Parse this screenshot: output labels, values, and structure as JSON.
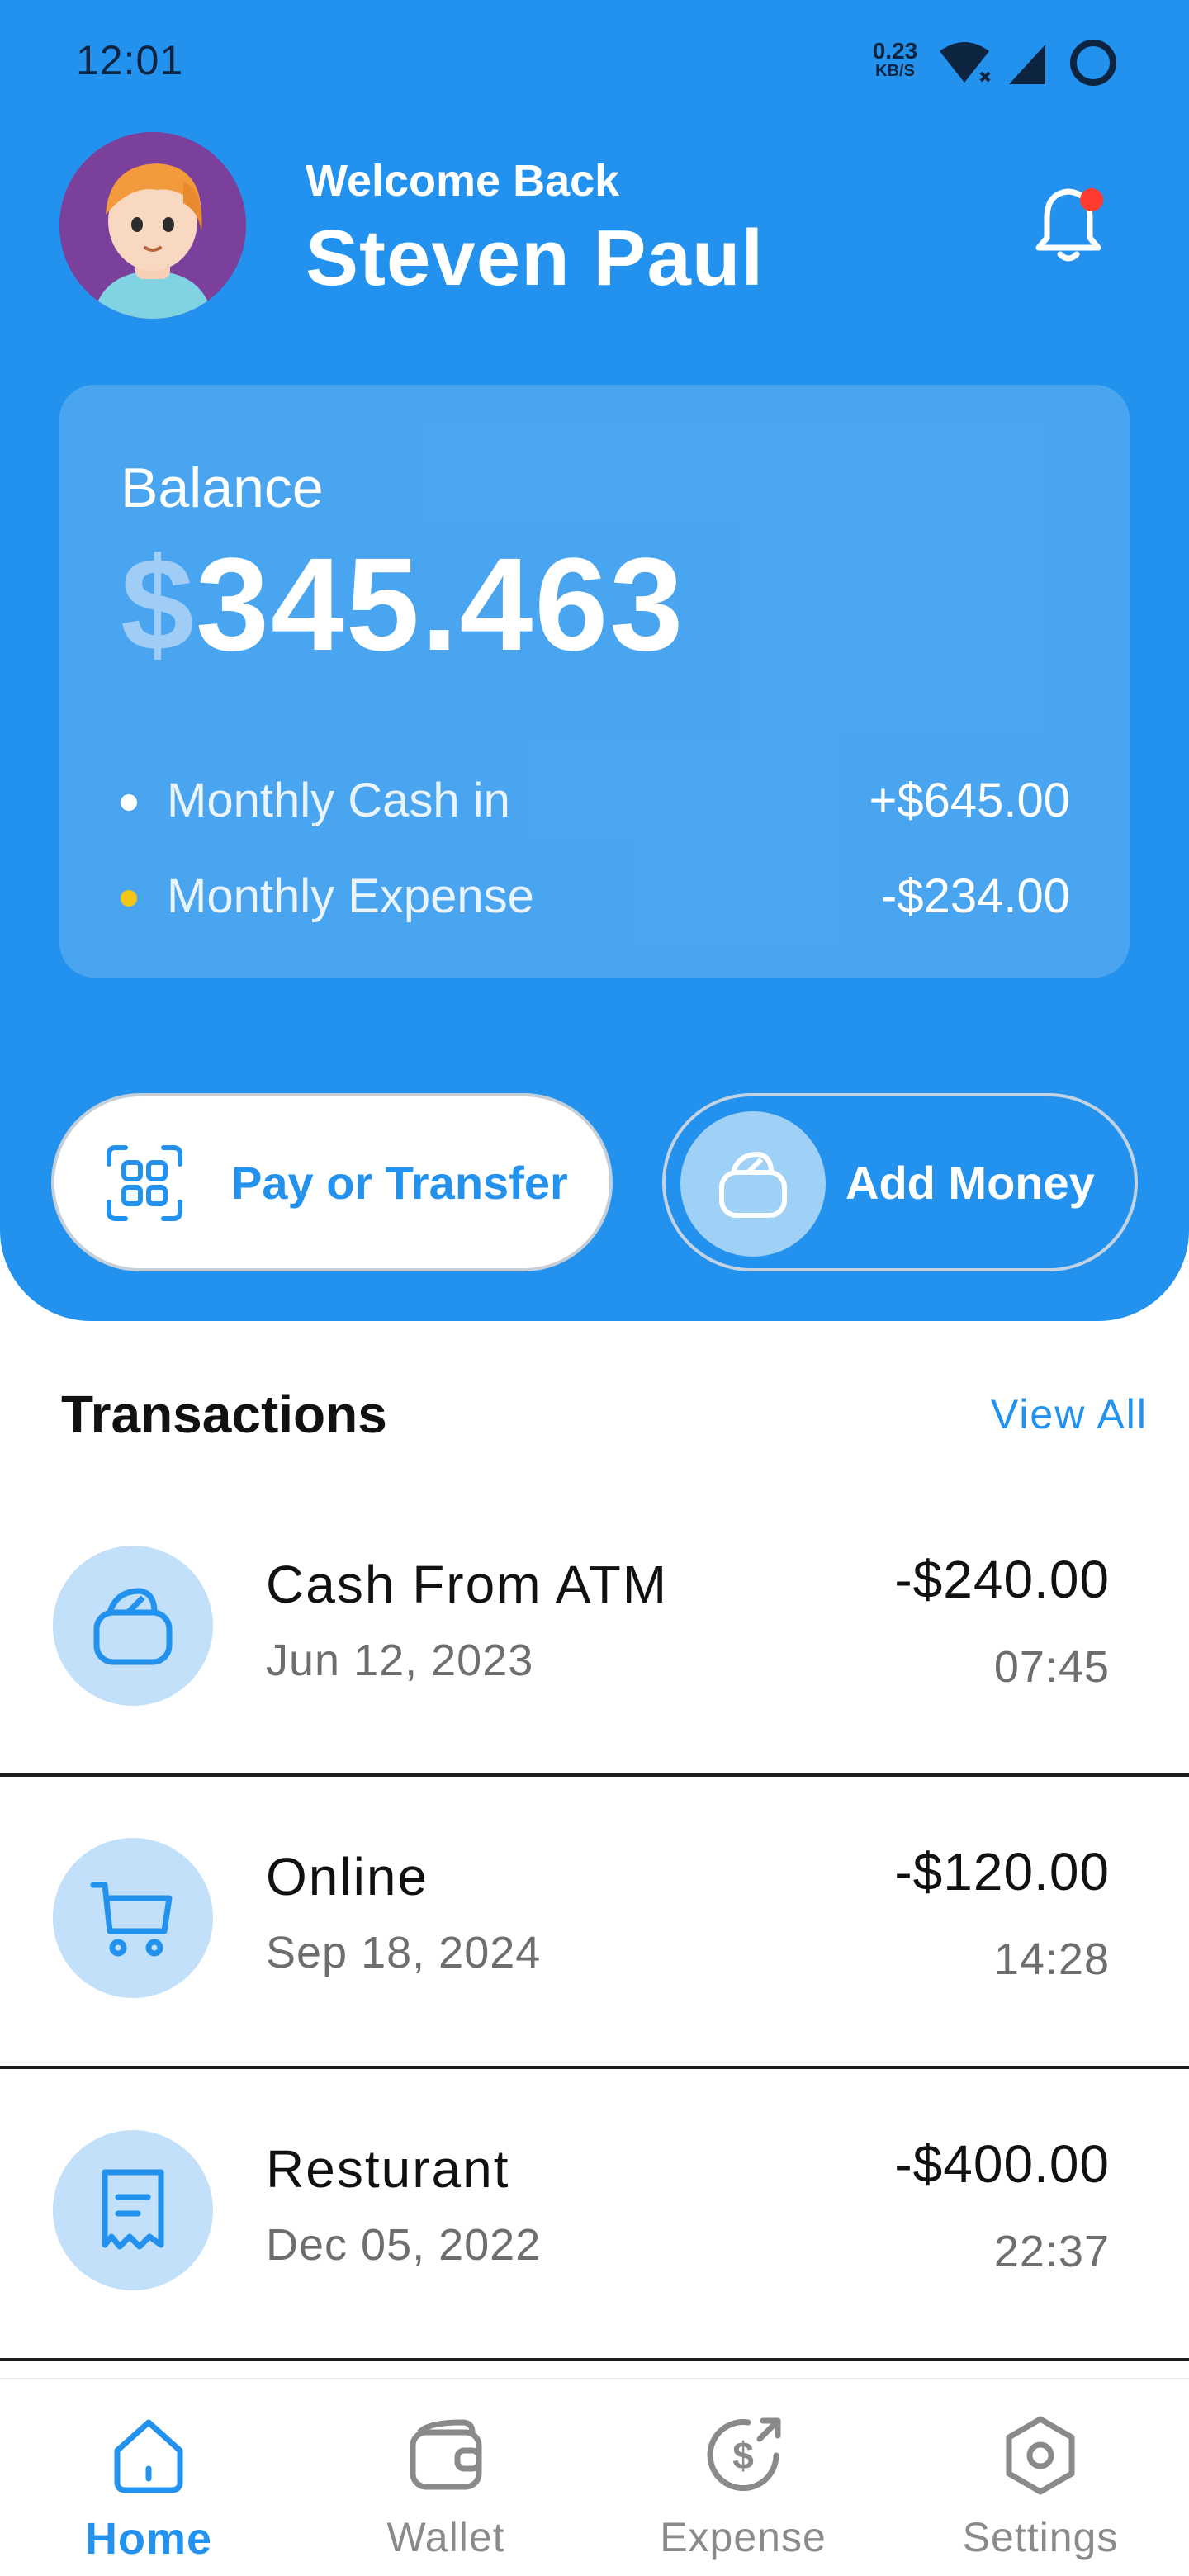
{
  "status_bar": {
    "time": "12:01",
    "speed_value": "0.23",
    "speed_unit": "KB/S"
  },
  "header": {
    "welcome": "Welcome Back",
    "user_name": "Steven Paul",
    "notification_dot": true
  },
  "balance": {
    "label": "Balance",
    "currency_symbol": "$",
    "amount": "345.463",
    "monthly_cash_in": {
      "label": "Monthly Cash in",
      "value": "+$645.00",
      "dot_color": "#ffffff"
    },
    "monthly_expense": {
      "label": "Monthly Expense",
      "value": "-$234.00",
      "dot_color": "#f5c518"
    }
  },
  "actions": {
    "pay_transfer": "Pay or Transfer",
    "add_money": "Add Money"
  },
  "transactions": {
    "title": "Transactions",
    "view_all": "View All",
    "items": [
      {
        "name": "Cash From ATM",
        "date": "Jun 12, 2023",
        "amount": "-$240.00",
        "time": "07:45",
        "icon": "wallet-icon"
      },
      {
        "name": "Online",
        "date": "Sep 18, 2024",
        "amount": "-$120.00",
        "time": "14:28",
        "icon": "cart-icon"
      },
      {
        "name": "Resturant",
        "date": "Dec 05, 2022",
        "amount": "-$400.00",
        "time": "22:37",
        "icon": "receipt-icon"
      }
    ]
  },
  "nav": {
    "home": "Home",
    "wallet": "Wallet",
    "expense": "Expense",
    "settings": "Settings",
    "active": "home"
  },
  "colors": {
    "primary": "#2392EE",
    "light_circle": "#c2e0fa",
    "expense_dot": "#f5c518",
    "notification": "#ff3b30"
  }
}
